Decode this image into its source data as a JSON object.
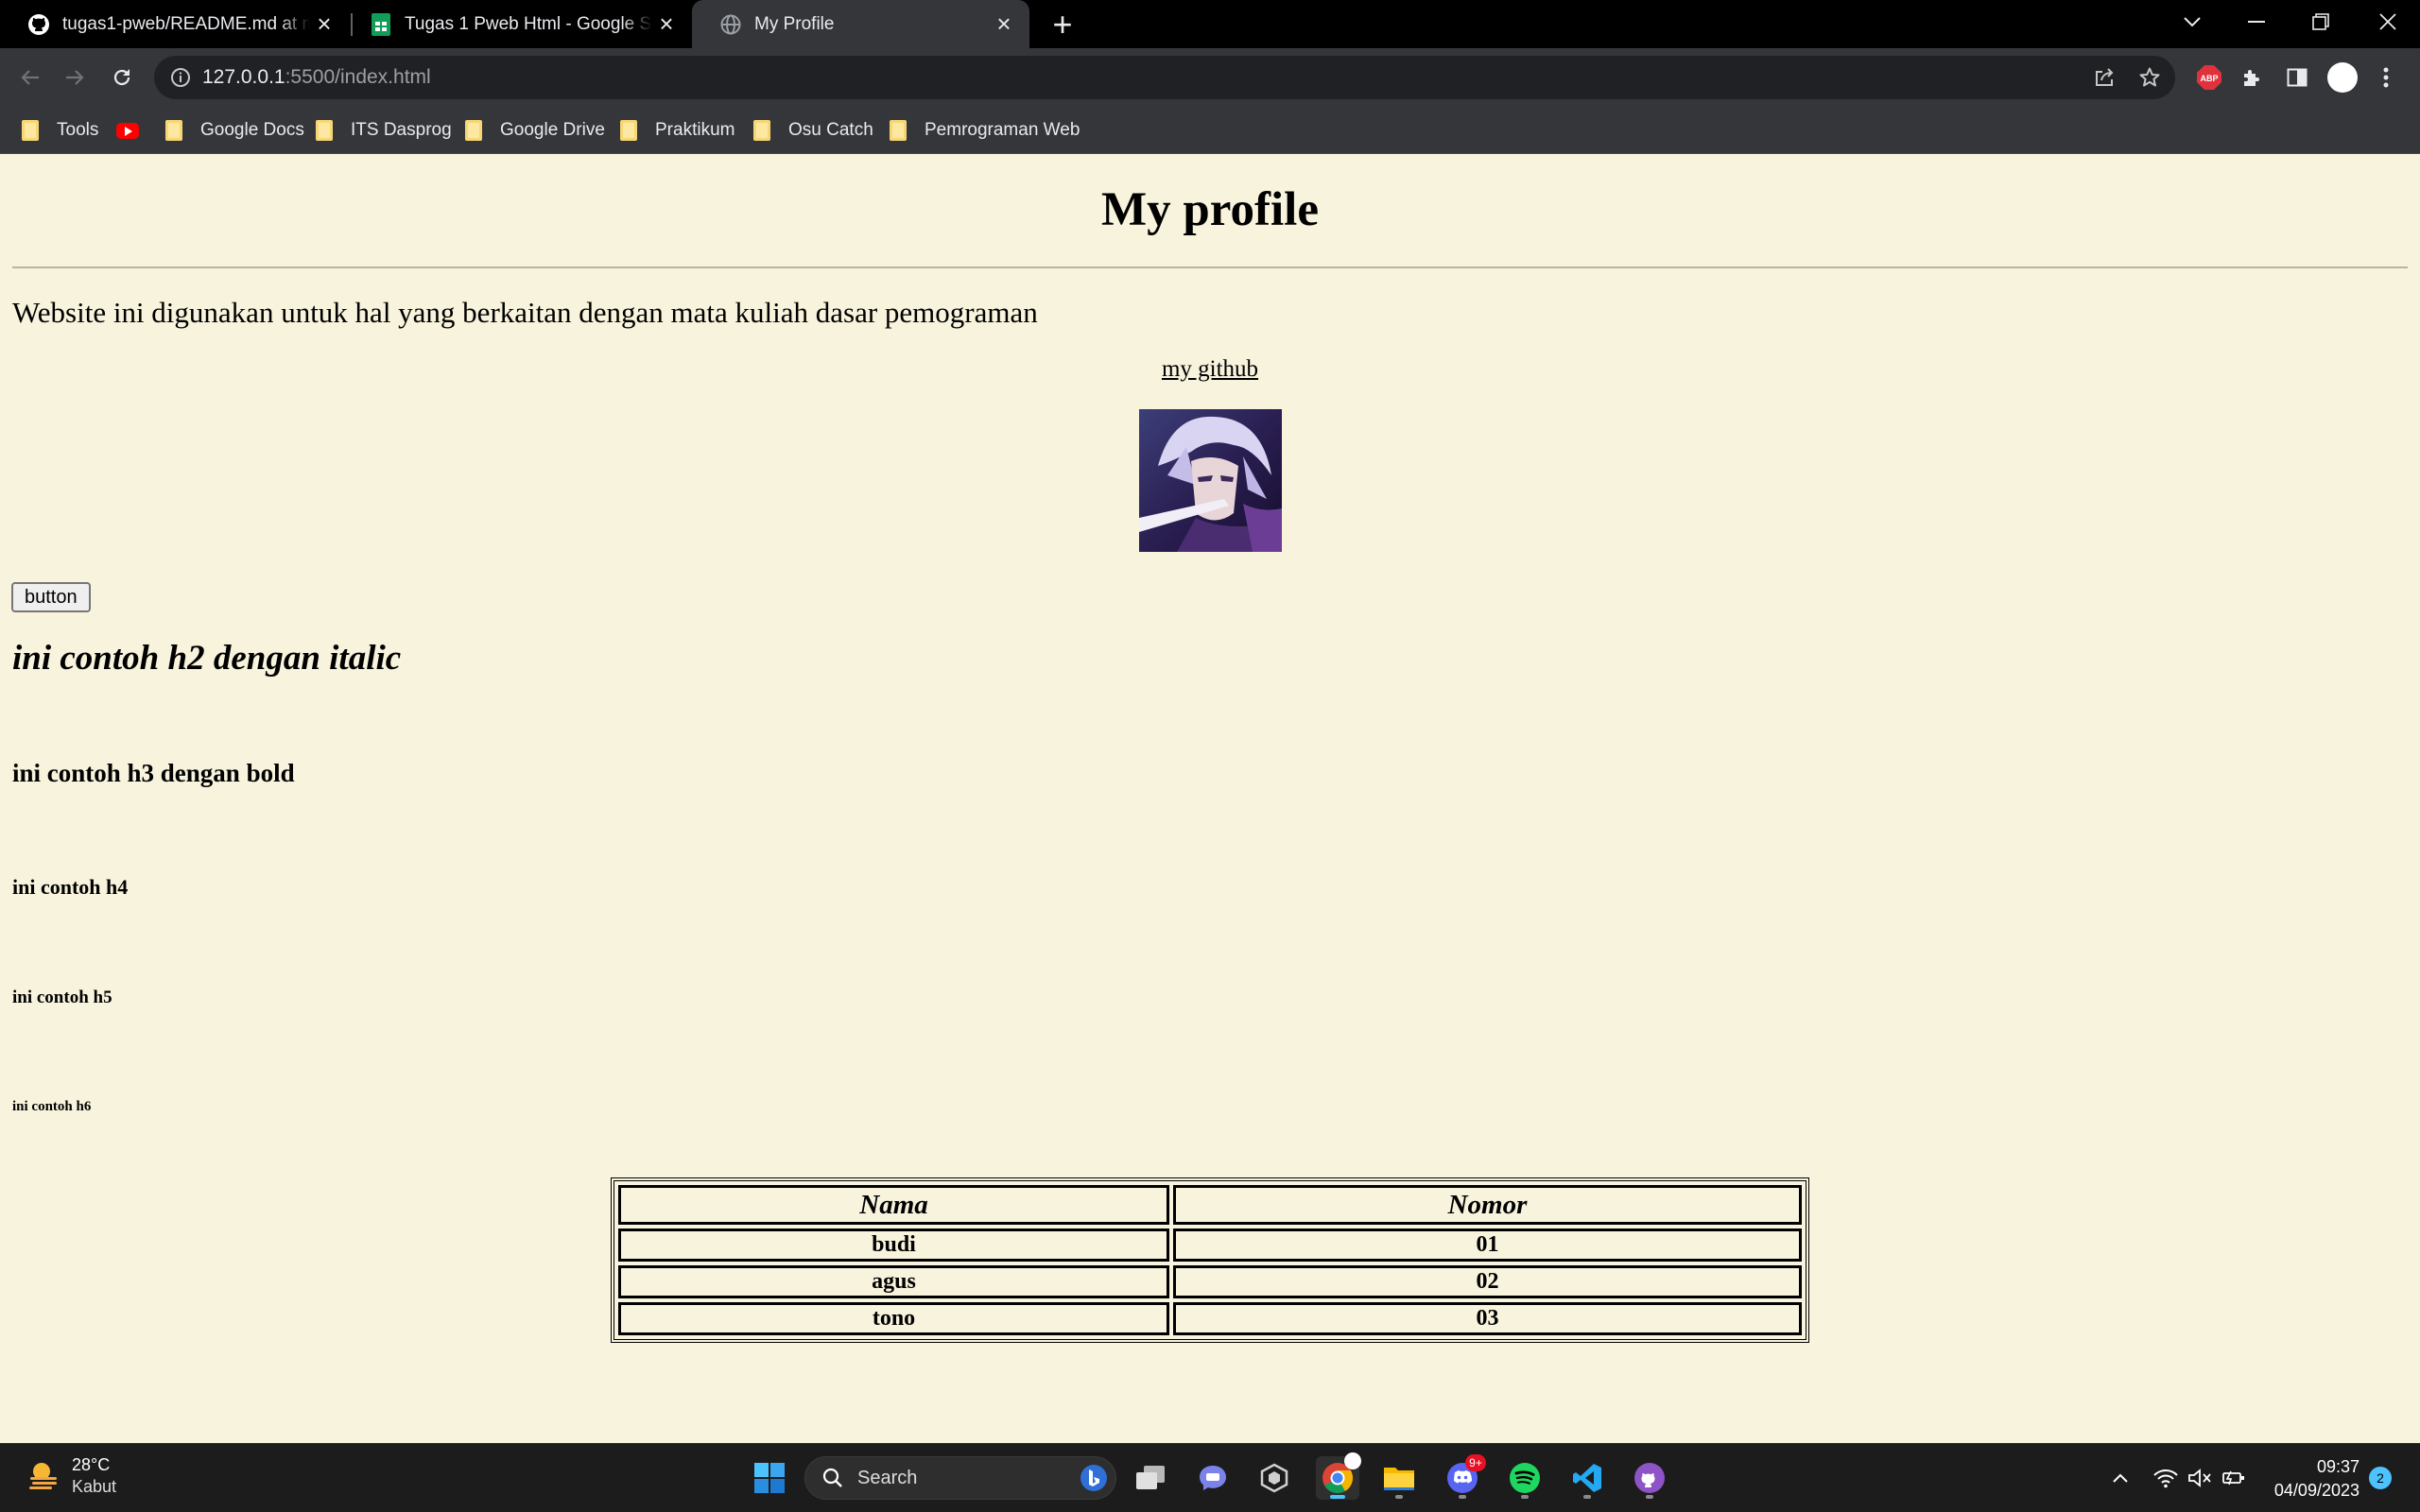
{
  "browser": {
    "tabs": [
      {
        "title": "tugas1-pweb/README.md at main",
        "favicon": "github-icon"
      },
      {
        "title": "Tugas 1 Pweb Html - Google Sheets",
        "favicon": "google-sheets-icon"
      },
      {
        "title": "My Profile",
        "favicon": "globe-icon",
        "active": true
      }
    ],
    "new_tab_label": "+",
    "url_host": "127.0.0.1",
    "url_rest": ":5500/index.html",
    "bookmarks": [
      {
        "label": "Tools",
        "icon": "folder-icon"
      },
      {
        "label": "",
        "icon": "youtube-icon"
      },
      {
        "label": "Google Docs",
        "icon": "folder-icon"
      },
      {
        "label": "ITS Dasprog",
        "icon": "folder-icon"
      },
      {
        "label": "Google Drive",
        "icon": "folder-icon"
      },
      {
        "label": "Praktikum",
        "icon": "folder-icon"
      },
      {
        "label": "Osu Catch",
        "icon": "folder-icon"
      },
      {
        "label": "Pemrograman Web",
        "icon": "folder-icon"
      }
    ],
    "extension_badge": "ABP"
  },
  "page": {
    "title": "My profile",
    "intro": "Website ini digunakan untuk hal yang berkaitan dengan mata kuliah dasar pemograman",
    "github_link": "my github",
    "button_label": "button",
    "h2": "ini contoh h2 dengan italic",
    "h3": "ini contoh h3 dengan bold",
    "h4": "ini contoh h4",
    "h5": "ini contoh h5",
    "h6": "ini contoh h6",
    "table": {
      "headers": [
        "Nama",
        "Nomor"
      ],
      "rows": [
        [
          "budi",
          "01"
        ],
        [
          "agus",
          "02"
        ],
        [
          "tono",
          "03"
        ]
      ]
    }
  },
  "taskbar": {
    "weather_temp": "28°C",
    "weather_desc": "Kabut",
    "search_label": "Search",
    "discord_badge": "9+",
    "time": "09:37",
    "date": "04/09/2023",
    "notification_count": "2"
  }
}
